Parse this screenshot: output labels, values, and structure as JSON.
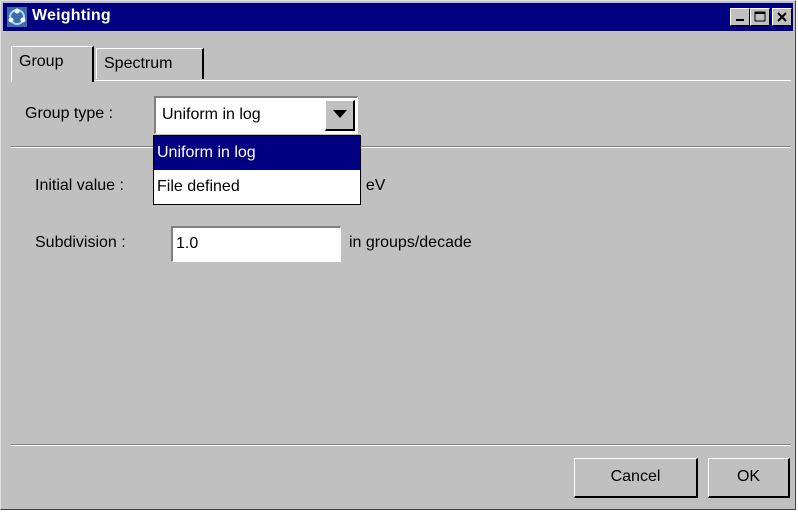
{
  "window": {
    "title": "Weighting",
    "icon": "app-molecule-icon",
    "controls": [
      "minimize-icon",
      "maximize-icon",
      "close-icon"
    ]
  },
  "tabs": [
    {
      "label": "Group",
      "selected": true
    },
    {
      "label": "Spectrum",
      "selected": false
    }
  ],
  "group": {
    "group_type_label": "Group type :",
    "group_type_value": "Uniform in log",
    "dropdown_options": [
      {
        "label": "Uniform in log",
        "highlighted": true
      },
      {
        "label": "File defined",
        "highlighted": false
      }
    ],
    "initial_value_label": "Initial value :",
    "initial_value": "",
    "initial_value_unit": "in eV",
    "subdivision_label": "Subdivision :",
    "subdivision_value": "1.0",
    "subdivision_unit": "in groups/decade"
  },
  "buttons": {
    "cancel": "Cancel",
    "ok": "OK"
  },
  "colors": {
    "titlebar": "#000080",
    "face": "#c0c0c0",
    "highlight": "#000080"
  }
}
